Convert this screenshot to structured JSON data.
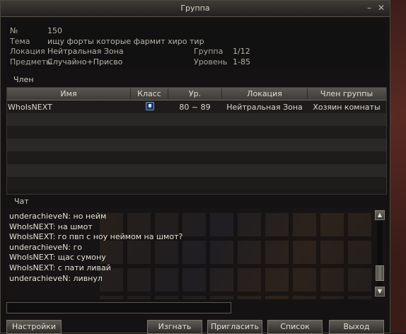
{
  "window": {
    "title": "Группа"
  },
  "info": {
    "number_label": "№",
    "number_value": "150",
    "theme_label": "Тема",
    "theme_value": "ищу форты которые фармит хиро тир",
    "location_label": "Локация",
    "location_value": "Нейтральная Зона",
    "items_label": "Предметы",
    "items_value": "Случайно+Присво",
    "group_label": "Группа",
    "group_value": "1/12",
    "level_label": "Уровень",
    "level_value": "1-85"
  },
  "members": {
    "section_label": "Член",
    "headers": [
      "Имя",
      "Класс",
      "Ур.",
      "Локация",
      "Член группы"
    ],
    "rows": [
      {
        "name": "WhoIsNEXT",
        "class_icon": "shield-icon",
        "level": "80 ~ 89",
        "location": "Нейтральная Зона",
        "role": "Хозяин комнаты"
      }
    ]
  },
  "chat": {
    "tab_label": "Чат",
    "lines": [
      "underachieveN: но нейм",
      "WhoIsNEXT: на шмот",
      "WhoIsNEXT: го пвп с ноу неймом на шмот?",
      "underachieveN: го",
      "WhoIsNEXT: щас сумону",
      "WhoIsNEXT: с пати ливай",
      "underachieveN: ливнул"
    ],
    "input_value": ""
  },
  "buttons": {
    "settings": "Настройки",
    "kick": "Изгнать",
    "invite": "Пригласить",
    "list": "Список",
    "exit": "Выход"
  },
  "colors": {
    "window_bg": "#141212",
    "header_bg": "#4a4744",
    "text": "#dcd8cc"
  }
}
